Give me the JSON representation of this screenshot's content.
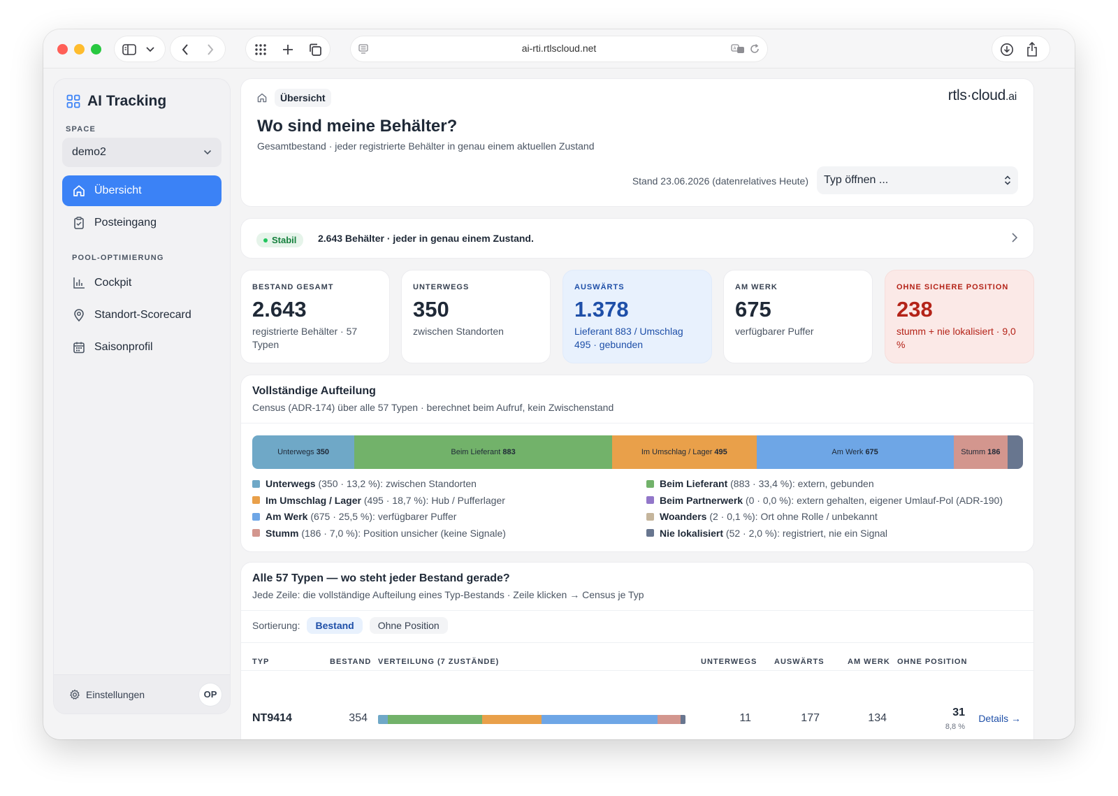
{
  "browser": {
    "url": "ai-rti.rtlscloud.net"
  },
  "sidebar": {
    "app_title": "AI Tracking",
    "space_label": "SPACE",
    "space_value": "demo2",
    "nav": [
      {
        "label": "Übersicht",
        "icon": "home-icon",
        "active": true
      },
      {
        "label": "Posteingang",
        "icon": "clipboard-icon",
        "active": false
      }
    ],
    "pool_label": "POOL-OPTIMIERUNG",
    "pool_nav": [
      {
        "label": "Cockpit",
        "icon": "bar-chart-icon"
      },
      {
        "label": "Standort-Scorecard",
        "icon": "map-pin-icon"
      },
      {
        "label": "Saisonprofil",
        "icon": "calendar-icon"
      }
    ],
    "settings_label": "Einstellungen",
    "avatar_initials": "OP"
  },
  "header": {
    "breadcrumb": "Übersicht",
    "logo_main": "rtls·cloud",
    "logo_suffix": ".ai",
    "title": "Wo sind meine Behälter?",
    "subtitle": "Gesamtbestand · jeder registrierte Behälter in genau einem aktuellen Zustand",
    "stand": "Stand 23.06.2026 (datenrelatives Heute)",
    "type_select": "Typ öffnen ..."
  },
  "status": {
    "badge": "Stabil",
    "text": "2.643 Behälter · jeder in genau einem Zustand."
  },
  "kpis": [
    {
      "label": "BESTAND GESAMT",
      "value": "2.643",
      "desc": "registrierte Behälter · 57 Typen",
      "variant": "default"
    },
    {
      "label": "UNTERWEGS",
      "value": "350",
      "desc": "zwischen Standorten",
      "variant": "default"
    },
    {
      "label": "AUSWÄRTS",
      "value": "1.378",
      "desc": "Lieferant 883 / Umschlag 495 · gebunden",
      "variant": "blue"
    },
    {
      "label": "AM WERK",
      "value": "675",
      "desc": "verfügbarer Puffer",
      "variant": "default"
    },
    {
      "label": "OHNE SICHERE POSITION",
      "value": "238",
      "desc": "stumm + nie lokalisiert · 9,0 %",
      "variant": "red"
    }
  ],
  "breakdown": {
    "title": "Vollständige Aufteilung",
    "subtitle": "Census (ADR-174) über alle 57 Typen · berechnet beim Aufruf, kein Zwischenstand",
    "segments": [
      {
        "label": "Unterwegs",
        "value": 350,
        "color": "#6fa8c7"
      },
      {
        "label": "Beim Lieferant",
        "value": 883,
        "color": "#72b26a"
      },
      {
        "label": "Im Umschlag / Lager",
        "value": 495,
        "color": "#e9a04a"
      },
      {
        "label": "Am Werk",
        "value": 675,
        "color": "#6ea6e6"
      },
      {
        "label": "Stumm",
        "value": 186,
        "color": "#d3968e"
      },
      {
        "label": "",
        "value": 52,
        "color": "#68768f"
      }
    ],
    "legend": [
      {
        "name": "Unterwegs",
        "detail": "(350 · 13,2 %): zwischen Standorten",
        "color": "#6fa8c7"
      },
      {
        "name": "Beim Lieferant",
        "detail": "(883 · 33,4 %): extern, gebunden",
        "color": "#72b26a"
      },
      {
        "name": "Im Umschlag / Lager",
        "detail": "(495 · 18,7 %): Hub / Pufferlager",
        "color": "#e9a04a"
      },
      {
        "name": "Beim Partnerwerk",
        "detail": "(0 · 0,0 %): extern gehalten, eigener Umlauf-Pol (ADR-190)",
        "color": "#9277c9"
      },
      {
        "name": "Am Werk",
        "detail": "(675 · 25,5 %): verfügbarer Puffer",
        "color": "#6ea6e6"
      },
      {
        "name": "Woanders",
        "detail": "(2 · 0,1 %): Ort ohne Rolle / unbekannt",
        "color": "#c5b59c"
      },
      {
        "name": "Stumm",
        "detail": "(186 · 7,0 %): Position unsicher (keine Signale)",
        "color": "#d3968e"
      },
      {
        "name": "Nie lokalisiert",
        "detail": "(52 · 2,0 %): registriert, nie ein Signal",
        "color": "#68768f"
      }
    ]
  },
  "types_table": {
    "title": "Alle 57 Typen — wo steht jeder Bestand gerade?",
    "subtitle": "Jede Zeile: die vollständige Aufteilung eines Typ-Bestands · Zeile klicken → Census je Typ",
    "sort_label": "Sortierung:",
    "sort_options": [
      {
        "label": "Bestand",
        "active": true
      },
      {
        "label": "Ohne Position",
        "active": false
      }
    ],
    "columns": {
      "typ": "TYP",
      "bestand": "BESTAND",
      "verteilung": "VERTEILUNG (7 ZUSTÄNDE)",
      "unterwegs": "UNTERWEGS",
      "auswaerts": "AUSWÄRTS",
      "am_werk": "AM WERK",
      "ohne_position": "OHNE POSITION"
    },
    "rows": [
      {
        "typ": "NT9414",
        "bestand": "354",
        "distribution": [
          {
            "value": 11,
            "color": "#6fa8c7"
          },
          {
            "value": 109,
            "color": "#72b26a"
          },
          {
            "value": 68,
            "color": "#e9a04a"
          },
          {
            "value": 134,
            "color": "#6ea6e6"
          },
          {
            "value": 26,
            "color": "#d3968e"
          },
          {
            "value": 6,
            "color": "#68768f"
          }
        ],
        "unterwegs": "11",
        "auswaerts": "177",
        "am_werk": "134",
        "ohne_position": "31",
        "ohne_position_pct": "8,8 %",
        "details": "Details →"
      }
    ]
  }
}
